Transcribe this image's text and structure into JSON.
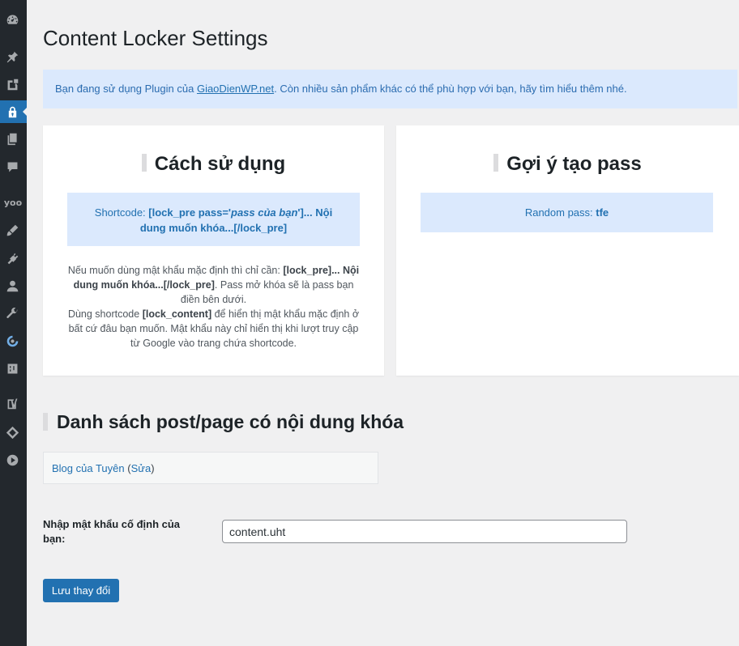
{
  "sidebar": {
    "icons": [
      "dashboard-icon",
      "pin-icon",
      "media-icon",
      "lock-icon",
      "pages-icon",
      "comments-icon",
      "yoo-icon",
      "appearance-icon",
      "plugins-icon",
      "users-icon",
      "tools-icon",
      "sync-icon",
      "settings-icon",
      "yoast-icon",
      "diamond-icon",
      "play-icon"
    ],
    "yoo_label": "yoo"
  },
  "page": {
    "title": "Content Locker Settings"
  },
  "notice": {
    "prefix": "Bạn đang sử dụng Plugin của ",
    "link": "GiaoDienWP.net",
    "suffix": ". Còn nhiều sản phẩm khác có thể phù hợp với bạn, hãy tìm hiểu thêm nhé."
  },
  "usage_card": {
    "heading": "Cách sử dụng",
    "shortcode_label": "Shortcode: ",
    "shortcode_open": "[lock_pre pass='",
    "shortcode_pass": "pass của bạn",
    "shortcode_close": "']... Nội dung muốn khóa...[/lock_pre]",
    "desc_1": "Nếu muốn dùng mật khẩu mặc định thì chỉ cần: ",
    "desc_1_code": "[lock_pre]... Nội dung muốn khóa...[/lock_pre]",
    "desc_1_end": ". Pass mở khóa sẽ là pass bạn điền bên dưới.",
    "desc_2": "Dùng shortcode ",
    "desc_2_code": "[lock_content]",
    "desc_2_end": " để hiển thị mật khẩu mặc định ở bất cứ đâu bạn muốn. Mật khẩu này chỉ hiển thị khi lượt truy cập từ Google vào trang chứa shortcode."
  },
  "pass_card": {
    "heading": "Gợi ý tạo pass",
    "random_label": "Random pass: ",
    "random_value": "tfe"
  },
  "locked_list": {
    "heading": "Danh sách post/page có nội dung khóa",
    "items": [
      {
        "title": "Blog của Tuyên",
        "edit_open": " (",
        "edit": "Sửa",
        "edit_close": ")"
      }
    ]
  },
  "password_form": {
    "label": "Nhập mật khẩu cố định của bạn:",
    "value": "content.uht"
  },
  "save_button": "Lưu thay đổi"
}
